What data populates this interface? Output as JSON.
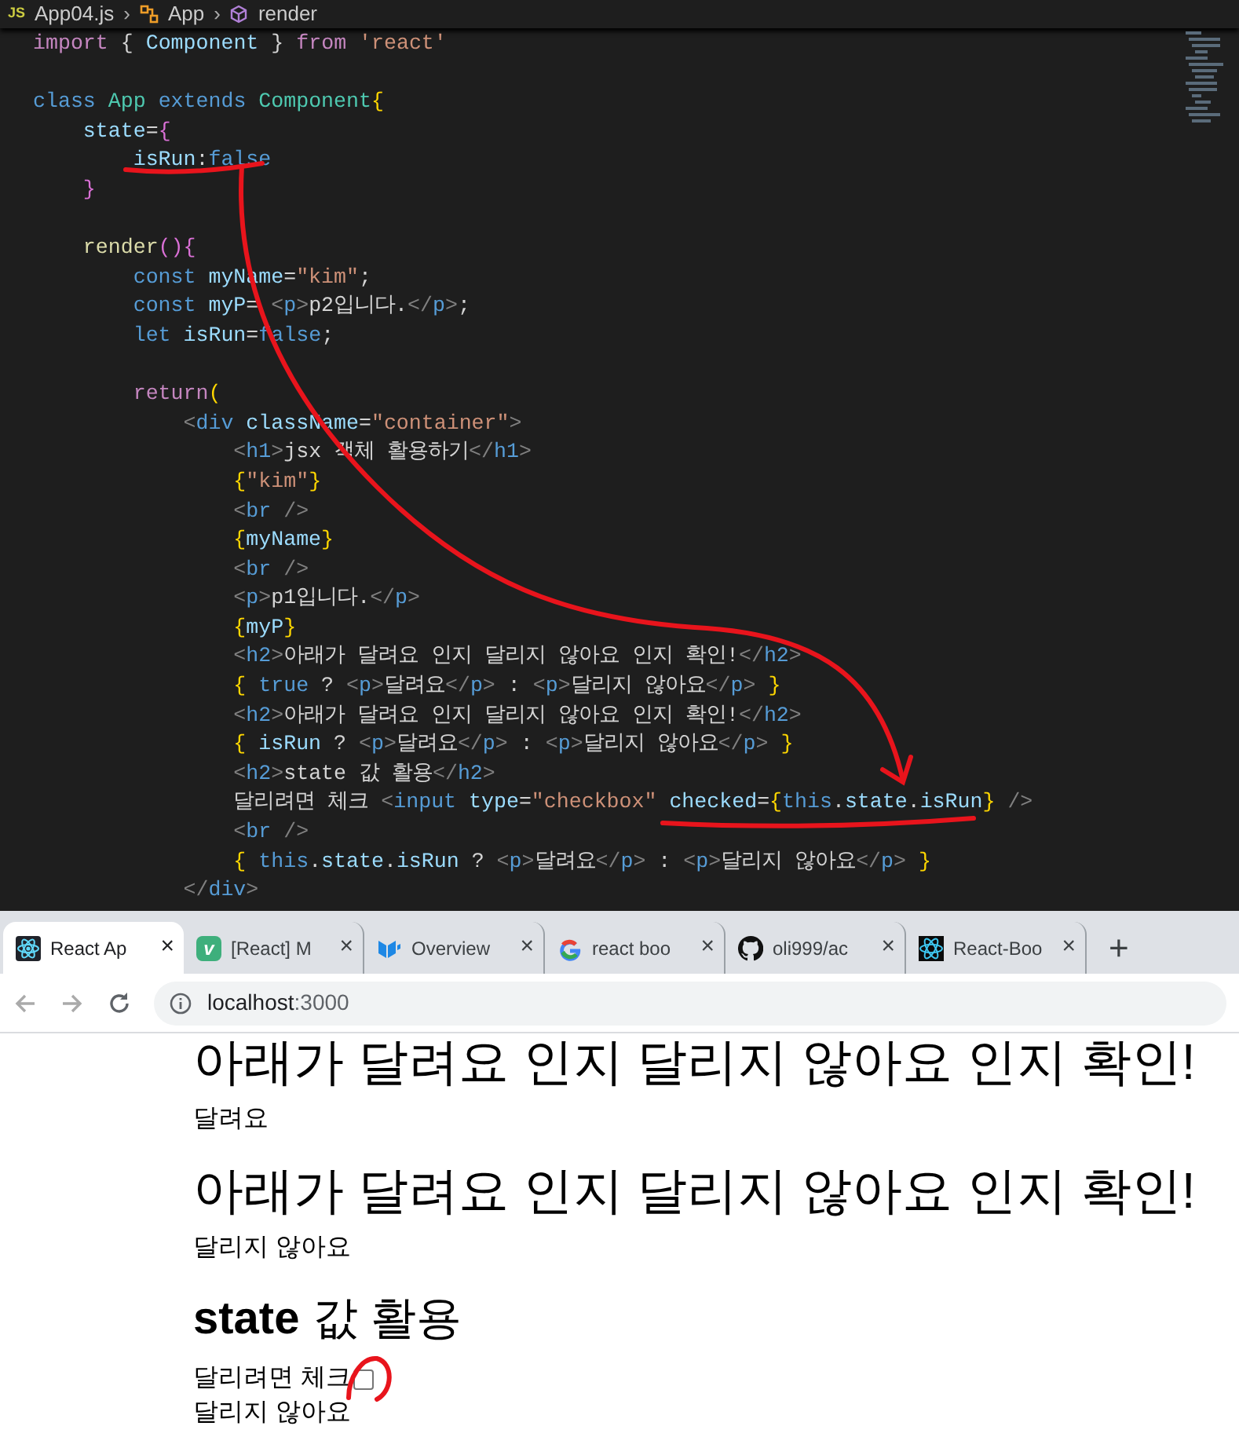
{
  "editor": {
    "file_badge": "JS",
    "separator": "›",
    "breadcrumb": [
      {
        "text": "App04.js",
        "kind": "file"
      },
      {
        "text": "App",
        "kind": "class"
      },
      {
        "text": "render",
        "kind": "method"
      }
    ],
    "lines": [
      {
        "kind": "code",
        "tokens": [
          {
            "t": "import",
            "kind": "control"
          },
          {
            "t": " { ",
            "kind": "plain"
          },
          {
            "t": "Component",
            "kind": "variable"
          },
          {
            "t": " } ",
            "kind": "plain"
          },
          {
            "t": "from",
            "kind": "control"
          },
          {
            "t": " 'react'",
            "kind": "string"
          }
        ]
      },
      {
        "kind": "blank"
      },
      {
        "kind": "code",
        "tokens": [
          {
            "t": "class ",
            "kind": "keyword"
          },
          {
            "t": "App ",
            "kind": "type"
          },
          {
            "t": "extends ",
            "kind": "keyword"
          },
          {
            "t": "Component",
            "kind": "type"
          },
          {
            "t": "{",
            "kind": "brace"
          }
        ]
      },
      {
        "kind": "code",
        "tokens": [
          {
            "t": "    state",
            "kind": "variable"
          },
          {
            "t": "=",
            "kind": "plain"
          },
          {
            "t": "{",
            "kind": "bracket"
          }
        ]
      },
      {
        "kind": "code",
        "tokens": [
          {
            "t": "        isRun",
            "kind": "variable"
          },
          {
            "t": ":",
            "kind": "plain"
          },
          {
            "t": "false",
            "kind": "keyword"
          }
        ]
      },
      {
        "kind": "code",
        "tokens": [
          {
            "t": "    }",
            "kind": "bracket"
          }
        ]
      },
      {
        "kind": "blank"
      },
      {
        "kind": "code",
        "tokens": [
          {
            "t": "    render",
            "kind": "function"
          },
          {
            "t": "()",
            "kind": "bracket"
          },
          {
            "t": "{",
            "kind": "bracket"
          }
        ]
      },
      {
        "kind": "code",
        "tokens": [
          {
            "t": "        const",
            "kind": "keyword"
          },
          {
            "t": " myName",
            "kind": "variable"
          },
          {
            "t": "=",
            "kind": "plain"
          },
          {
            "t": "\"kim\"",
            "kind": "string"
          },
          {
            "t": ";",
            "kind": "plain"
          }
        ]
      },
      {
        "kind": "code",
        "tokens": [
          {
            "t": "        const",
            "kind": "keyword"
          },
          {
            "t": " myP",
            "kind": "variable"
          },
          {
            "t": "= ",
            "kind": "plain"
          },
          {
            "t": "<",
            "kind": "punct"
          },
          {
            "t": "p",
            "kind": "keyword"
          },
          {
            "t": ">",
            "kind": "punct"
          },
          {
            "t": "p2입니다.",
            "kind": "plain"
          },
          {
            "t": "</",
            "kind": "punct"
          },
          {
            "t": "p",
            "kind": "keyword"
          },
          {
            "t": ">",
            "kind": "punct"
          },
          {
            "t": ";",
            "kind": "plain"
          }
        ]
      },
      {
        "kind": "code",
        "tokens": [
          {
            "t": "        let",
            "kind": "keyword"
          },
          {
            "t": " isRun",
            "kind": "variable"
          },
          {
            "t": "=",
            "kind": "plain"
          },
          {
            "t": "false",
            "kind": "keyword"
          },
          {
            "t": ";",
            "kind": "plain"
          }
        ]
      },
      {
        "kind": "blank"
      },
      {
        "kind": "code",
        "tokens": [
          {
            "t": "        return",
            "kind": "control"
          },
          {
            "t": "(",
            "kind": "brace"
          }
        ]
      },
      {
        "kind": "code",
        "tokens": [
          {
            "t": "            <",
            "kind": "punct"
          },
          {
            "t": "div",
            "kind": "keyword"
          },
          {
            "t": " className",
            "kind": "variable"
          },
          {
            "t": "=",
            "kind": "plain"
          },
          {
            "t": "\"container\"",
            "kind": "string"
          },
          {
            "t": ">",
            "kind": "punct"
          }
        ]
      },
      {
        "kind": "code",
        "tokens": [
          {
            "t": "                <",
            "kind": "punct"
          },
          {
            "t": "h1",
            "kind": "keyword"
          },
          {
            "t": ">",
            "kind": "punct"
          },
          {
            "t": "jsx 객체 활용하기",
            "kind": "plain"
          },
          {
            "t": "</",
            "kind": "punct"
          },
          {
            "t": "h1",
            "kind": "keyword"
          },
          {
            "t": ">",
            "kind": "punct"
          }
        ]
      },
      {
        "kind": "code",
        "tokens": [
          {
            "t": "                {",
            "kind": "brace"
          },
          {
            "t": "\"kim\"",
            "kind": "string"
          },
          {
            "t": "}",
            "kind": "brace"
          }
        ]
      },
      {
        "kind": "code",
        "tokens": [
          {
            "t": "                <",
            "kind": "punct"
          },
          {
            "t": "br",
            "kind": "keyword"
          },
          {
            "t": " />",
            "kind": "punct"
          }
        ]
      },
      {
        "kind": "code",
        "tokens": [
          {
            "t": "                {",
            "kind": "brace"
          },
          {
            "t": "myName",
            "kind": "variable"
          },
          {
            "t": "}",
            "kind": "brace"
          }
        ]
      },
      {
        "kind": "code",
        "tokens": [
          {
            "t": "                <",
            "kind": "punct"
          },
          {
            "t": "br",
            "kind": "keyword"
          },
          {
            "t": " />",
            "kind": "punct"
          }
        ]
      },
      {
        "kind": "code",
        "tokens": [
          {
            "t": "                <",
            "kind": "punct"
          },
          {
            "t": "p",
            "kind": "keyword"
          },
          {
            "t": ">",
            "kind": "punct"
          },
          {
            "t": "p1입니다.",
            "kind": "plain"
          },
          {
            "t": "</",
            "kind": "punct"
          },
          {
            "t": "p",
            "kind": "keyword"
          },
          {
            "t": ">",
            "kind": "punct"
          }
        ]
      },
      {
        "kind": "code",
        "tokens": [
          {
            "t": "                {",
            "kind": "brace"
          },
          {
            "t": "myP",
            "kind": "variable"
          },
          {
            "t": "}",
            "kind": "brace"
          }
        ]
      },
      {
        "kind": "code",
        "tokens": [
          {
            "t": "                <",
            "kind": "punct"
          },
          {
            "t": "h2",
            "kind": "keyword"
          },
          {
            "t": ">",
            "kind": "punct"
          },
          {
            "t": "아래가 달려요 인지 달리지 않아요 인지 확인!",
            "kind": "plain"
          },
          {
            "t": "</",
            "kind": "punct"
          },
          {
            "t": "h2",
            "kind": "keyword"
          },
          {
            "t": ">",
            "kind": "punct"
          }
        ]
      },
      {
        "kind": "code",
        "tokens": [
          {
            "t": "                {",
            "kind": "brace"
          },
          {
            "t": " true",
            "kind": "keyword"
          },
          {
            "t": " ? ",
            "kind": "plain"
          },
          {
            "t": "<",
            "kind": "punct"
          },
          {
            "t": "p",
            "kind": "keyword"
          },
          {
            "t": ">",
            "kind": "punct"
          },
          {
            "t": "달려요",
            "kind": "plain"
          },
          {
            "t": "</",
            "kind": "punct"
          },
          {
            "t": "p",
            "kind": "keyword"
          },
          {
            "t": ">",
            "kind": "punct"
          },
          {
            "t": " : ",
            "kind": "plain"
          },
          {
            "t": "<",
            "kind": "punct"
          },
          {
            "t": "p",
            "kind": "keyword"
          },
          {
            "t": ">",
            "kind": "punct"
          },
          {
            "t": "달리지 않아요",
            "kind": "plain"
          },
          {
            "t": "</",
            "kind": "punct"
          },
          {
            "t": "p",
            "kind": "keyword"
          },
          {
            "t": ">",
            "kind": "punct"
          },
          {
            "t": " }",
            "kind": "brace"
          }
        ]
      },
      {
        "kind": "code",
        "tokens": [
          {
            "t": "                <",
            "kind": "punct"
          },
          {
            "t": "h2",
            "kind": "keyword"
          },
          {
            "t": ">",
            "kind": "punct"
          },
          {
            "t": "아래가 달려요 인지 달리지 않아요 인지 확인!",
            "kind": "plain"
          },
          {
            "t": "</",
            "kind": "punct"
          },
          {
            "t": "h2",
            "kind": "keyword"
          },
          {
            "t": ">",
            "kind": "punct"
          }
        ]
      },
      {
        "kind": "code",
        "tokens": [
          {
            "t": "                {",
            "kind": "brace"
          },
          {
            "t": " isRun",
            "kind": "variable"
          },
          {
            "t": " ? ",
            "kind": "plain"
          },
          {
            "t": "<",
            "kind": "punct"
          },
          {
            "t": "p",
            "kind": "keyword"
          },
          {
            "t": ">",
            "kind": "punct"
          },
          {
            "t": "달려요",
            "kind": "plain"
          },
          {
            "t": "</",
            "kind": "punct"
          },
          {
            "t": "p",
            "kind": "keyword"
          },
          {
            "t": ">",
            "kind": "punct"
          },
          {
            "t": " : ",
            "kind": "plain"
          },
          {
            "t": "<",
            "kind": "punct"
          },
          {
            "t": "p",
            "kind": "keyword"
          },
          {
            "t": ">",
            "kind": "punct"
          },
          {
            "t": "달리지 않아요",
            "kind": "plain"
          },
          {
            "t": "</",
            "kind": "punct"
          },
          {
            "t": "p",
            "kind": "keyword"
          },
          {
            "t": ">",
            "kind": "punct"
          },
          {
            "t": " }",
            "kind": "brace"
          }
        ]
      },
      {
        "kind": "code",
        "tokens": [
          {
            "t": "                <",
            "kind": "punct"
          },
          {
            "t": "h2",
            "kind": "keyword"
          },
          {
            "t": ">",
            "kind": "punct"
          },
          {
            "t": "state 값 활용",
            "kind": "plain"
          },
          {
            "t": "</",
            "kind": "punct"
          },
          {
            "t": "h2",
            "kind": "keyword"
          },
          {
            "t": ">",
            "kind": "punct"
          }
        ]
      },
      {
        "kind": "code",
        "tokens": [
          {
            "t": "                달리려면 체크 ",
            "kind": "plain"
          },
          {
            "t": "<",
            "kind": "punct"
          },
          {
            "t": "input",
            "kind": "keyword"
          },
          {
            "t": " type",
            "kind": "variable"
          },
          {
            "t": "=",
            "kind": "plain"
          },
          {
            "t": "\"checkbox\"",
            "kind": "string"
          },
          {
            "t": " checked",
            "kind": "variable"
          },
          {
            "t": "=",
            "kind": "plain"
          },
          {
            "t": "{",
            "kind": "brace"
          },
          {
            "t": "this",
            "kind": "keyword"
          },
          {
            "t": ".",
            "kind": "plain"
          },
          {
            "t": "state",
            "kind": "variable"
          },
          {
            "t": ".",
            "kind": "plain"
          },
          {
            "t": "isRun",
            "kind": "variable"
          },
          {
            "t": "}",
            "kind": "brace"
          },
          {
            "t": " />",
            "kind": "punct"
          }
        ]
      },
      {
        "kind": "code",
        "tokens": [
          {
            "t": "                <",
            "kind": "punct"
          },
          {
            "t": "br",
            "kind": "keyword"
          },
          {
            "t": " />",
            "kind": "punct"
          }
        ]
      },
      {
        "kind": "code",
        "tokens": [
          {
            "t": "                {",
            "kind": "brace"
          },
          {
            "t": " this",
            "kind": "keyword"
          },
          {
            "t": ".",
            "kind": "plain"
          },
          {
            "t": "state",
            "kind": "variable"
          },
          {
            "t": ".",
            "kind": "plain"
          },
          {
            "t": "isRun",
            "kind": "variable"
          },
          {
            "t": " ? ",
            "kind": "plain"
          },
          {
            "t": "<",
            "kind": "punct"
          },
          {
            "t": "p",
            "kind": "keyword"
          },
          {
            "t": ">",
            "kind": "punct"
          },
          {
            "t": "달려요",
            "kind": "plain"
          },
          {
            "t": "</",
            "kind": "punct"
          },
          {
            "t": "p",
            "kind": "keyword"
          },
          {
            "t": ">",
            "kind": "punct"
          },
          {
            "t": " : ",
            "kind": "plain"
          },
          {
            "t": "<",
            "kind": "punct"
          },
          {
            "t": "p",
            "kind": "keyword"
          },
          {
            "t": ">",
            "kind": "punct"
          },
          {
            "t": "달리지 않아요",
            "kind": "plain"
          },
          {
            "t": "</",
            "kind": "punct"
          },
          {
            "t": "p",
            "kind": "keyword"
          },
          {
            "t": ">",
            "kind": "punct"
          },
          {
            "t": " }",
            "kind": "brace"
          }
        ]
      },
      {
        "kind": "code",
        "tokens": [
          {
            "t": "            </",
            "kind": "punct"
          },
          {
            "t": "div",
            "kind": "keyword"
          },
          {
            "t": ">",
            "kind": "punct"
          }
        ]
      }
    ]
  },
  "browser": {
    "tabs": [
      {
        "title": "React Ap",
        "kind": "react",
        "close": "×",
        "selected": true
      },
      {
        "title": "[React] M",
        "kind": "letter",
        "favicon_text": "v",
        "close": "×",
        "selected": false
      },
      {
        "title": "Overview",
        "kind": "mui",
        "close": "×",
        "selected": false
      },
      {
        "title": "react boo",
        "kind": "google",
        "close": "×",
        "selected": false
      },
      {
        "title": "oli999/ac",
        "kind": "github",
        "close": "×",
        "selected": false
      },
      {
        "title": "React-Boo",
        "kind": "bootstrap",
        "close": "×",
        "selected": false
      }
    ],
    "new_tab": "+",
    "url_host": "localhost",
    "url_port": ":3000",
    "page": [
      {
        "kind": "h2",
        "text": "아래가 달려요 인지 달리지 않아요 인지 확인!"
      },
      {
        "kind": "p",
        "text": "달려요"
      },
      {
        "kind": "h2",
        "text": "아래가 달려요 인지 달리지 않아요 인지 확인!"
      },
      {
        "kind": "p",
        "text": "달리지 않아요"
      },
      {
        "kind": "h2bold",
        "bold": "state",
        "text": "값 활용"
      },
      {
        "kind": "checkbox",
        "text": "달리려면 체크",
        "checked": false
      },
      {
        "kind": "p",
        "text": "달리지 않아요"
      }
    ]
  }
}
